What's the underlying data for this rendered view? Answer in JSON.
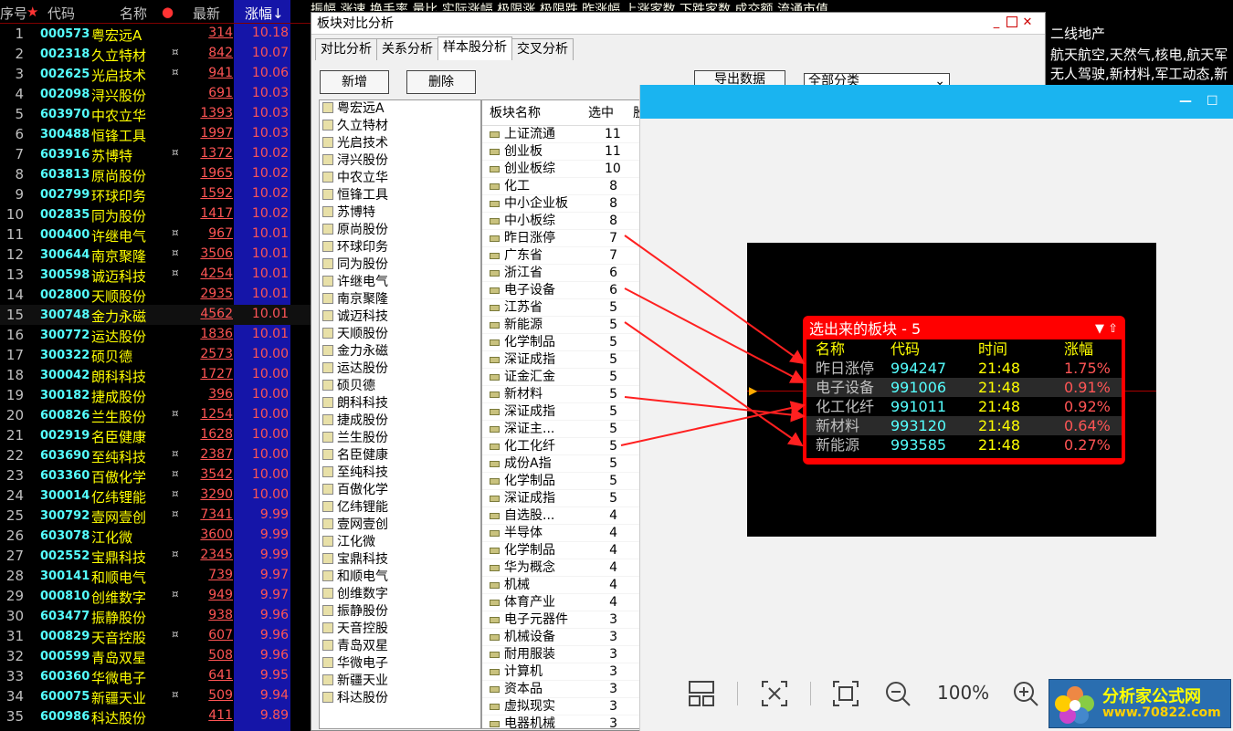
{
  "stock_header": {
    "seq": "序号",
    "code": "代码",
    "name": "名称",
    "mark": "●",
    "price": "最新",
    "chg": "涨幅↓"
  },
  "stocks": [
    {
      "no": "1",
      "code": "000573",
      "name": "粤宏远A",
      "star": "",
      "price": "314",
      "chg": "10.18"
    },
    {
      "no": "2",
      "code": "002318",
      "name": "久立特材",
      "star": "¤",
      "price": "842",
      "chg": "10.07"
    },
    {
      "no": "3",
      "code": "002625",
      "name": "光启技术",
      "star": "¤",
      "price": "941",
      "chg": "10.06"
    },
    {
      "no": "4",
      "code": "002098",
      "name": "浔兴股份",
      "star": "",
      "price": "691",
      "chg": "10.03"
    },
    {
      "no": "5",
      "code": "603970",
      "name": "中农立华",
      "star": "",
      "price": "1393",
      "chg": "10.03"
    },
    {
      "no": "6",
      "code": "300488",
      "name": "恒锋工具",
      "star": "",
      "price": "1997",
      "chg": "10.03"
    },
    {
      "no": "7",
      "code": "603916",
      "name": "苏博特",
      "star": "¤",
      "price": "1372",
      "chg": "10.02"
    },
    {
      "no": "8",
      "code": "603813",
      "name": "原尚股份",
      "star": "",
      "price": "1965",
      "chg": "10.02"
    },
    {
      "no": "9",
      "code": "002799",
      "name": "环球印务",
      "star": "",
      "price": "1592",
      "chg": "10.02"
    },
    {
      "no": "10",
      "code": "002835",
      "name": "同为股份",
      "star": "",
      "price": "1417",
      "chg": "10.02"
    },
    {
      "no": "11",
      "code": "000400",
      "name": "许继电气",
      "star": "¤",
      "price": "967",
      "chg": "10.01"
    },
    {
      "no": "12",
      "code": "300644",
      "name": "南京聚隆",
      "star": "¤",
      "price": "3506",
      "chg": "10.01"
    },
    {
      "no": "13",
      "code": "300598",
      "name": "诚迈科技",
      "star": "¤",
      "price": "4254",
      "chg": "10.01"
    },
    {
      "no": "14",
      "code": "002800",
      "name": "天顺股份",
      "star": "",
      "price": "2935",
      "chg": "10.01"
    },
    {
      "no": "15",
      "code": "300748",
      "name": "金力永磁",
      "star": "",
      "price": "4562",
      "chg": "10.01"
    },
    {
      "no": "16",
      "code": "300772",
      "name": "运达股份",
      "star": "",
      "price": "1836",
      "chg": "10.01"
    },
    {
      "no": "17",
      "code": "300322",
      "name": "硕贝德",
      "star": "",
      "price": "2573",
      "chg": "10.00"
    },
    {
      "no": "18",
      "code": "300042",
      "name": "朗科科技",
      "star": "",
      "price": "1727",
      "chg": "10.00"
    },
    {
      "no": "19",
      "code": "300182",
      "name": "捷成股份",
      "star": "",
      "price": "396",
      "chg": "10.00"
    },
    {
      "no": "20",
      "code": "600826",
      "name": "兰生股份",
      "star": "¤",
      "price": "1254",
      "chg": "10.00"
    },
    {
      "no": "21",
      "code": "002919",
      "name": "名臣健康",
      "star": "",
      "price": "1628",
      "chg": "10.00"
    },
    {
      "no": "22",
      "code": "603690",
      "name": "至纯科技",
      "star": "¤",
      "price": "2387",
      "chg": "10.00"
    },
    {
      "no": "23",
      "code": "603360",
      "name": "百傲化学",
      "star": "¤",
      "price": "3542",
      "chg": "10.00"
    },
    {
      "no": "24",
      "code": "300014",
      "name": "亿纬锂能",
      "star": "¤",
      "price": "3290",
      "chg": "10.00"
    },
    {
      "no": "25",
      "code": "300792",
      "name": "壹网壹创",
      "star": "¤",
      "price": "7341",
      "chg": "9.99"
    },
    {
      "no": "26",
      "code": "603078",
      "name": "江化微",
      "star": "",
      "price": "3600",
      "chg": "9.99"
    },
    {
      "no": "27",
      "code": "002552",
      "name": "宝鼎科技",
      "star": "¤",
      "price": "2345",
      "chg": "9.99"
    },
    {
      "no": "28",
      "code": "300141",
      "name": "和顺电气",
      "star": "",
      "price": "739",
      "chg": "9.97"
    },
    {
      "no": "29",
      "code": "000810",
      "name": "创维数字",
      "star": "¤",
      "price": "949",
      "chg": "9.97"
    },
    {
      "no": "30",
      "code": "603477",
      "name": "振静股份",
      "star": "",
      "price": "938",
      "chg": "9.96"
    },
    {
      "no": "31",
      "code": "000829",
      "name": "天音控股",
      "star": "¤",
      "price": "607",
      "chg": "9.96"
    },
    {
      "no": "32",
      "code": "000599",
      "name": "青岛双星",
      "star": "",
      "price": "508",
      "chg": "9.96"
    },
    {
      "no": "33",
      "code": "600360",
      "name": "华微电子",
      "star": "",
      "price": "641",
      "chg": "9.95"
    },
    {
      "no": "34",
      "code": "600075",
      "name": "新疆天业",
      "star": "¤",
      "price": "509",
      "chg": "9.94"
    },
    {
      "no": "35",
      "code": "600986",
      "name": "科达股份",
      "star": "",
      "price": "411",
      "chg": "9.89"
    }
  ],
  "top_columns": "振幅 涨速 换手率 量比 实际涨幅 极限涨 极限跌 昨涨幅 上涨家数 下跌家数 成交额 流通市值",
  "right_strip": [
    "二线地产",
    "航天航空,天然气,核电,航天军",
    "无人驾驶,新材料,军工动态,新"
  ],
  "compare_window": {
    "title": "板块对比分析",
    "tabs": [
      "对比分析",
      "关系分析",
      "样本股分析",
      "交叉分析"
    ],
    "add": "新增",
    "delete": "删除",
    "export": "导出数据",
    "filter": "全部分类",
    "sector_head": {
      "name": "板块名称",
      "count": "选中",
      "more": "股"
    },
    "stocks_in_box": [
      "粤宏远A",
      "久立特材",
      "光启技术",
      "浔兴股份",
      "中农立华",
      "恒锋工具",
      "苏博特",
      "原尚股份",
      "环球印务",
      "同为股份",
      "许继电气",
      "南京聚隆",
      "诚迈科技",
      "天顺股份",
      "金力永磁",
      "运达股份",
      "硕贝德",
      "朗科科技",
      "捷成股份",
      "兰生股份",
      "名臣健康",
      "至纯科技",
      "百傲化学",
      "亿纬锂能",
      "壹网壹创",
      "江化微",
      "宝鼎科技",
      "和顺电气",
      "创维数字",
      "振静股份",
      "天音控股",
      "青岛双星",
      "华微电子",
      "新疆天业",
      "科达股份"
    ],
    "sectors": [
      {
        "name": "上证流通",
        "count": "11"
      },
      {
        "name": "创业板",
        "count": "11"
      },
      {
        "name": "创业板综",
        "count": "10"
      },
      {
        "name": "化工",
        "count": "8"
      },
      {
        "name": "中小企业板",
        "count": "8"
      },
      {
        "name": "中小板综",
        "count": "8"
      },
      {
        "name": "昨日涨停",
        "count": "7"
      },
      {
        "name": "广东省",
        "count": "7"
      },
      {
        "name": "浙江省",
        "count": "6"
      },
      {
        "name": "电子设备",
        "count": "6"
      },
      {
        "name": "江苏省",
        "count": "5"
      },
      {
        "name": "新能源",
        "count": "5"
      },
      {
        "name": "化学制品",
        "count": "5"
      },
      {
        "name": "深证成指",
        "count": "5"
      },
      {
        "name": "证金汇金",
        "count": "5"
      },
      {
        "name": "新材料",
        "count": "5"
      },
      {
        "name": "深证成指",
        "count": "5"
      },
      {
        "name": "深证主...",
        "count": "5"
      },
      {
        "name": "化工化纤",
        "count": "5"
      },
      {
        "name": "成份A指",
        "count": "5"
      },
      {
        "name": "化学制品",
        "count": "5"
      },
      {
        "name": "深证成指",
        "count": "5"
      },
      {
        "name": "自选股...",
        "count": "4"
      },
      {
        "name": "半导体",
        "count": "4"
      },
      {
        "name": "化学制品",
        "count": "4"
      },
      {
        "name": "华为概念",
        "count": "4"
      },
      {
        "name": "机械",
        "count": "4"
      },
      {
        "name": "体育产业",
        "count": "4"
      },
      {
        "name": "电子元器件",
        "count": "3"
      },
      {
        "name": "机械设备",
        "count": "3"
      },
      {
        "name": "耐用服装",
        "count": "3"
      },
      {
        "name": "计算机",
        "count": "3"
      },
      {
        "name": "资本品",
        "count": "3"
      },
      {
        "name": "虚拟现实",
        "count": "3"
      },
      {
        "name": "电器机械",
        "count": "3"
      }
    ]
  },
  "popup": {
    "title": "选出来的板块 - 5",
    "head": {
      "name": "名称",
      "code": "代码",
      "time": "时间",
      "rate": "涨幅"
    },
    "rows": [
      {
        "name": "昨日涨停",
        "code": "994247",
        "time": "21:48",
        "rate": "1.75%"
      },
      {
        "name": "电子设备",
        "code": "991006",
        "time": "21:48",
        "rate": "0.91%"
      },
      {
        "name": "化工化纤",
        "code": "991011",
        "time": "21:48",
        "rate": "0.92%"
      },
      {
        "name": "新材料",
        "code": "993120",
        "time": "21:48",
        "rate": "0.64%"
      },
      {
        "name": "新能源",
        "code": "993585",
        "time": "21:48",
        "rate": "0.27%"
      }
    ]
  },
  "viewer": {
    "zoom": "100%",
    "minimize": "—",
    "maximize": "☐"
  },
  "logo": {
    "name": "分析家公式网",
    "url": "www.70822.com"
  },
  "colors": {
    "accent": "#1ab4f0",
    "up": "#ff5555",
    "code": "#55ffff",
    "name": "#ffff00"
  }
}
